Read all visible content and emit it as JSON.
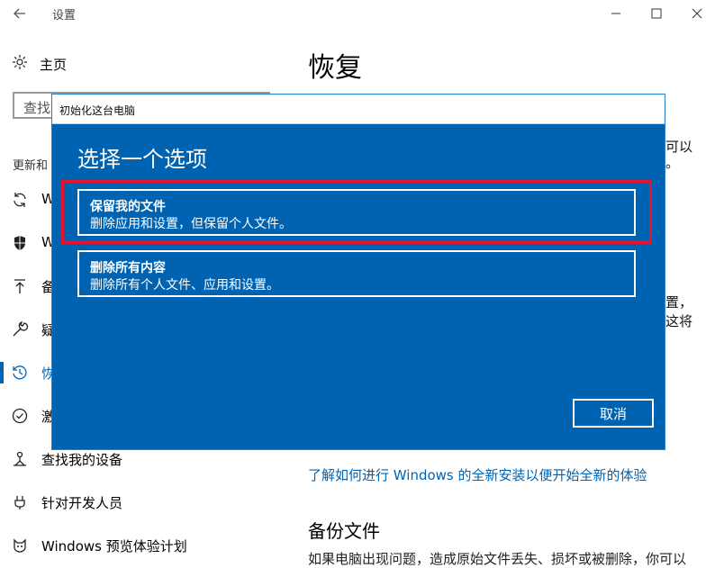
{
  "window": {
    "title": "设置"
  },
  "sidebar": {
    "home_label": "主页",
    "search_placeholder": "查找",
    "section_heading": "更新和",
    "items": [
      {
        "label": "W",
        "icon": "sync-icon"
      },
      {
        "label": "W",
        "icon": "shield-icon"
      },
      {
        "label": "备",
        "icon": "upload-icon"
      },
      {
        "label": "疑",
        "icon": "wrench-icon"
      },
      {
        "label": "恢",
        "icon": "history-icon",
        "active": true
      },
      {
        "label": "激",
        "icon": "check-circle-icon"
      },
      {
        "label": "查找我的设备",
        "icon": "person-location-icon"
      },
      {
        "label": "针对开发人员",
        "icon": "developer-icon"
      },
      {
        "label": "Windows 预览体验计划",
        "icon": "cat-icon"
      }
    ]
  },
  "main": {
    "title": "恢复",
    "partial_1": "可以",
    "partial_2": "。",
    "partial_3": "置，",
    "partial_4": "这将",
    "fresh_start_link": "了解如何进行 Windows 的全新安装以便开始全新的体验",
    "backup_title": "备份文件",
    "backup_desc": "如果电脑出现问题，造成原始文件丢失、损坏或被删除，你可以"
  },
  "dialog": {
    "title": "初始化这台电脑",
    "heading": "选择一个选项",
    "options": [
      {
        "title": "保留我的文件",
        "desc": "删除应用和设置，但保留个人文件。"
      },
      {
        "title": "删除所有内容",
        "desc": "删除所有个人文件、应用和设置。"
      }
    ],
    "cancel_label": "取消"
  },
  "colors": {
    "accent": "#0063b1",
    "dialog_bg": "#0063b1",
    "highlight": "#e8112d"
  }
}
